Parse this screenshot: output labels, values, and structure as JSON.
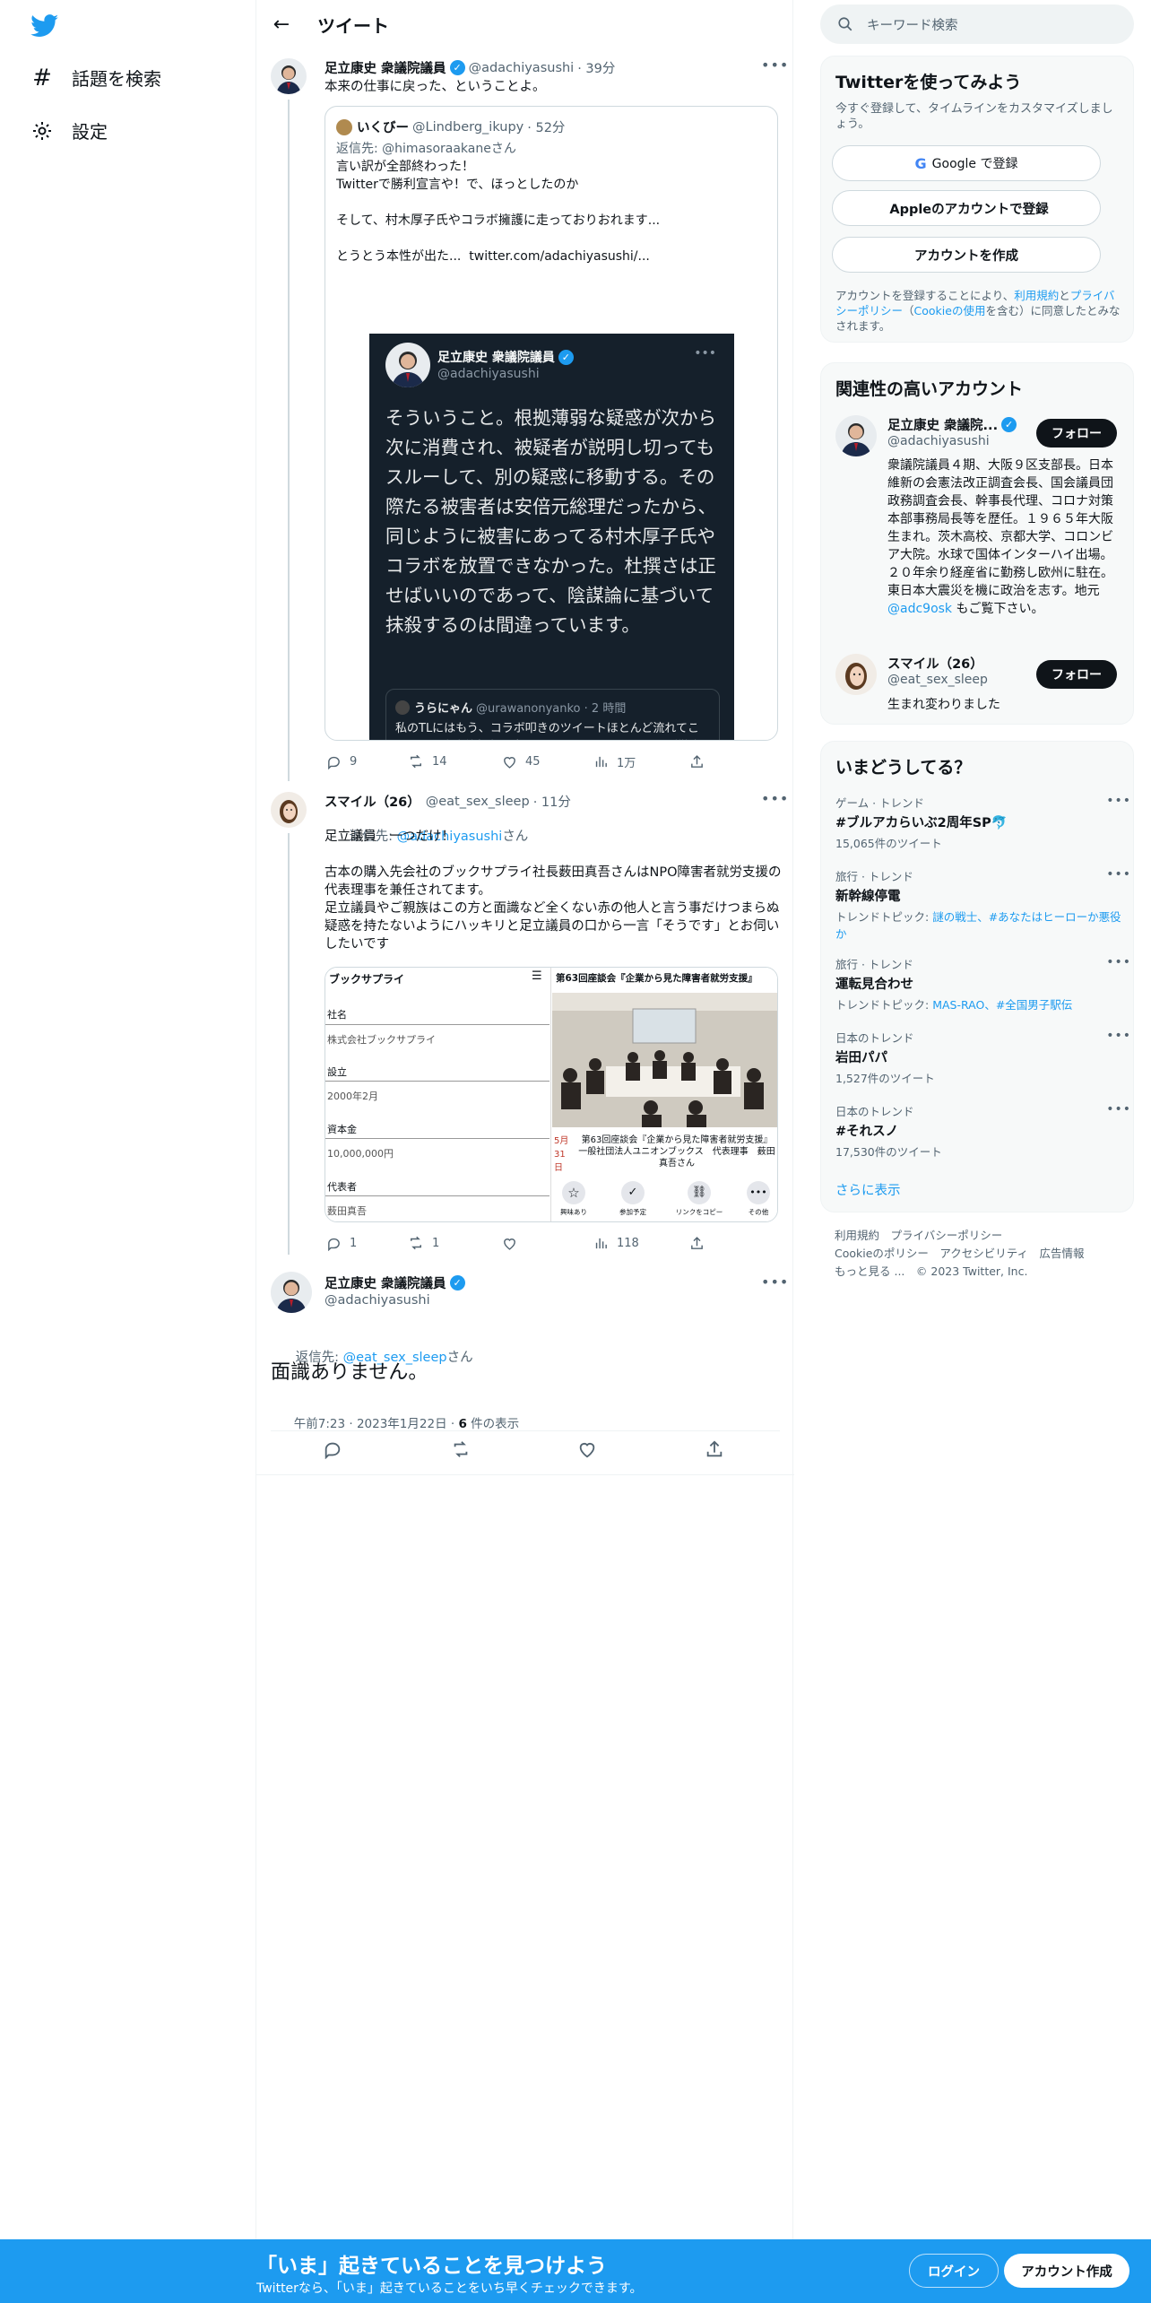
{
  "nav": {
    "explore_label": "話題を検索",
    "settings_label": "設定"
  },
  "header": {
    "title": "ツイート"
  },
  "tweet1": {
    "name": "足立康史 衆議院議員",
    "handle": "@adachiyasushi",
    "time": "· 39分",
    "text": "本来の仕事に戻った、ということよ。",
    "quote": {
      "name": "いくびー",
      "handle": "@Lindberg_ikupy",
      "time": "· 52分",
      "reply_to": "返信先: @himasoraakaneさん",
      "text": "言い訳が全部終わった！\nTwitterで勝利宣言や！で、ほっとしたのか\n\nそして、村木厚子氏やコラボ擁護に走っておりおれます...\n\nとうとう本性が出た...  twitter.com/adachiyasushi/...",
      "card": {
        "name": "足立康史 衆議院議員",
        "handle": "@adachiyasushi",
        "more": "•••",
        "text": "そういうこと。根拠薄弱な疑惑が次から次に消費され、被疑者が説明し切ってもスルーして、別の疑惑に移動する。その際たる被害者は安倍元総理だったから、同じように被害にあってる村木厚子氏やコラボを放置できなかった。杜撰さは正せばいいのであって、陰謀論に基づいて抹殺するのは間違っています。",
        "inner_name": "うらにゃん",
        "inner_handle": "@urawanonyanko · 2 時間",
        "inner_text": "私のTLにはもう、コラボ叩きのツイートほとんど流れてこない。足立家族批判に変わってるの？ KAZUYAさんが徹底して上念さんも関連動画配信したり...も気づく..."
      }
    },
    "stats": {
      "replies": "9",
      "retweets": "14",
      "likes": "45",
      "views": "1万"
    }
  },
  "tweet2": {
    "name": "スマイル（26）",
    "handle": "@eat_sex_sleep",
    "time": "· 11分",
    "reply_prefix": "返信先: ",
    "reply_handle": "@adachiyasushi",
    "reply_suffix": "さん",
    "text": "足立議員　一つだけ！\n\n古本の購入先会社のブックサプライ社長薮田真吾さんはNPO障害者就労支援の代表理事を兼任されてます。\n足立議員やご親族はこの方と面識など全くない赤の他人と言う事だけつまらぬ疑惑を持たないようにハッキリと足立議員の口から一言「そうです」とお伺いしたいです",
    "media": {
      "left_title": "ブックサプライ",
      "f1_label": "社名",
      "f1_value": "株式会社ブックサプライ",
      "f2_label": "設立",
      "f2_value": "2000年2月",
      "f3_label": "資本金",
      "f3_value": "10,000,000円",
      "f4_label": "代表者",
      "f4_value": "薮田真吾",
      "right_title": "第63回座談会『企業から見た障害者就労支援』",
      "caption": "第63回座談会『企業から見た障害者就労支援』一般社団法人ユニオンブックス　代表理事　薮田 真吾さん",
      "date_fragment": "5月\n31日",
      "btn1": "興味あり",
      "btn2": "参加予定",
      "btn3": "リンクをコピー",
      "btn4": "その他"
    },
    "stats": {
      "replies": "1",
      "retweets": "1",
      "likes": "",
      "views": "118"
    }
  },
  "main": {
    "name": "足立康史 衆議院議員",
    "handle": "@adachiyasushi",
    "reply_prefix": "返信先: ",
    "reply_handle": "@eat_sex_sleep",
    "reply_suffix": "さん",
    "text": "面識ありません。",
    "time": "午前7:23 · 2023年1月22日 · ",
    "views_count": "6",
    "views_label": " 件の表示"
  },
  "right": {
    "search_placeholder": "キーワード検索",
    "signup_panel": {
      "title": "Twitterを使ってみよう",
      "subtitle": "今すぐ登録して、タイムラインをカスタマイズしましょう。",
      "google": "Google で登録",
      "apple": "Appleのアカウントで登録",
      "create": "アカウントを作成",
      "legal_a": "アカウントを登録することにより、",
      "legal_terms": "利用規約",
      "legal_b": "と",
      "legal_privacy": "プライバシーポリシー",
      "legal_c": "（",
      "legal_cookie": "Cookieの使用",
      "legal_d": "を含む）に同意したとみなされます。"
    },
    "related": {
      "title": "関連性の高いアカウント",
      "acct1_name": "足立康史 衆議院...",
      "acct1_handle": "@adachiyasushi",
      "acct1_bio": "衆議院議員４期、大阪９区支部長。日本維新の会憲法改正調査会長、国会議員団政務調査会長、幹事長代理、コロナ対策本部事務局長等を歴任。１９６５年大阪生まれ。茨木高校、京都大学、コロンビア大院。水球で国体インターハイ出場。２０年余り経産省に勤務し欧州に駐在。東日本大震災を機に政治を志す。地元 ",
      "acct1_bio_link": "@adc9osk",
      "acct1_bio_end": " もご覧下さい。",
      "acct2_name": "スマイル（26）",
      "acct2_handle": "@eat_sex_sleep",
      "acct2_bio": "生まれ変わりました",
      "follow": "フォロー"
    },
    "trends": {
      "title": "いまどうしてる？",
      "items": [
        {
          "cat": "ゲーム · トレンド",
          "name": "#ブルアカらいぶ2周年SP🐬",
          "sub": "15,065件のツイート"
        },
        {
          "cat": "旅行 · トレンド",
          "name": "新幹線停電",
          "sub_prefix": "トレンドトピック: ",
          "sub_links": "謎の戦士、#あなたはヒーローか悪役か"
        },
        {
          "cat": "旅行 · トレンド",
          "name": "運転見合わせ",
          "sub_prefix": "トレンドトピック: ",
          "sub_links": "MAS-RAO、#全国男子駅伝"
        },
        {
          "cat": "日本のトレンド",
          "name": "岩田パパ",
          "sub": "1,527件のツイート"
        },
        {
          "cat": "日本のトレンド",
          "name": "#それスノ",
          "sub": "17,530件のツイート"
        }
      ],
      "show_more": "さらに表示"
    },
    "footer": {
      "line1": "利用規約　プライバシーポリシー",
      "line2": "Cookieのポリシー　アクセシビリティ　広告情報",
      "line3": "もっと見る ...　© 2023 Twitter, Inc."
    }
  },
  "bottom": {
    "title": "「いま」起きていることを見つけよう",
    "subtitle": "Twitterなら、「いま」起きていることをいち早くチェックできます。",
    "login": "ログイン",
    "signup": "アカウント作成"
  },
  "colors": {
    "accent": "#1d9bf0",
    "text": "#0f1419",
    "muted": "#536471",
    "dark_card": "#15202b"
  }
}
